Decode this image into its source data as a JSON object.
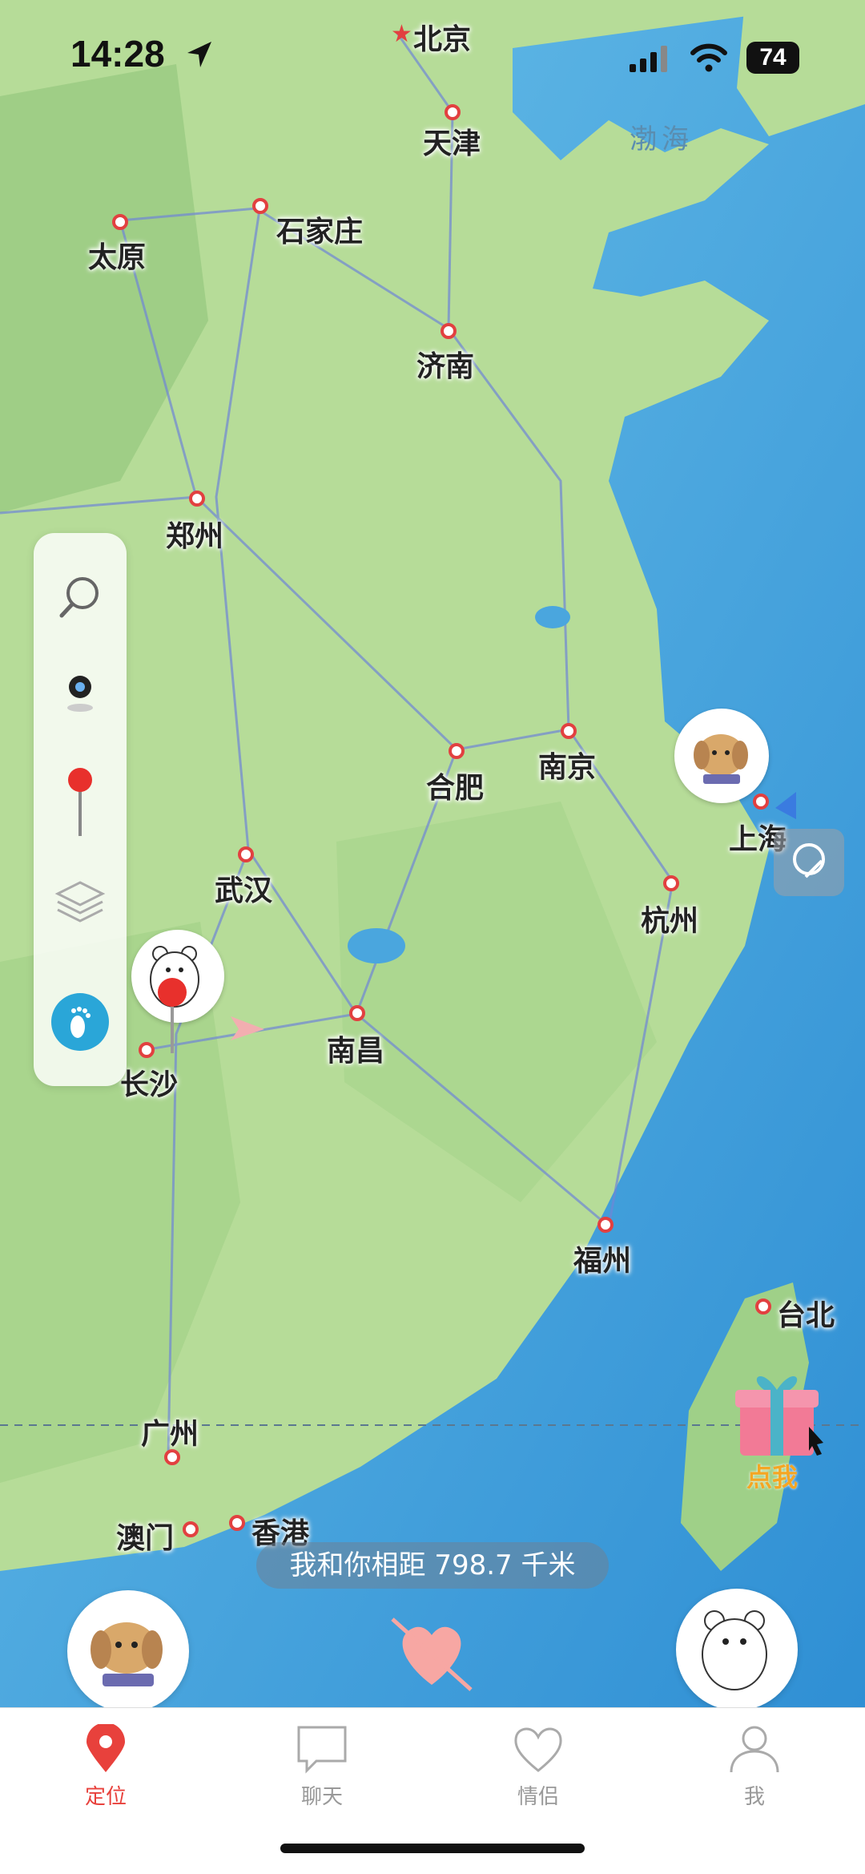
{
  "status_bar": {
    "time": "14:28",
    "battery": "74"
  },
  "map": {
    "cities": [
      {
        "id": "beijing",
        "name": "北京"
      },
      {
        "id": "tianjin",
        "name": "天津"
      },
      {
        "id": "taiyuan",
        "name": "太原"
      },
      {
        "id": "shijiazhuang",
        "name": "石家庄"
      },
      {
        "id": "jinan",
        "name": "济南"
      },
      {
        "id": "zhengzhou",
        "name": "郑州"
      },
      {
        "id": "nanjing",
        "name": "南京"
      },
      {
        "id": "hefei",
        "name": "合肥"
      },
      {
        "id": "shanghai",
        "name": "上海"
      },
      {
        "id": "wuhan",
        "name": "武汉"
      },
      {
        "id": "hangzhou",
        "name": "杭州"
      },
      {
        "id": "changsha",
        "name": "长沙"
      },
      {
        "id": "nanchang",
        "name": "南昌"
      },
      {
        "id": "fuzhou",
        "name": "福州"
      },
      {
        "id": "taibei",
        "name": "台北"
      },
      {
        "id": "guangzhou",
        "name": "广州"
      },
      {
        "id": "aomen",
        "name": "澳门"
      },
      {
        "id": "xianggang",
        "name": "香港"
      }
    ],
    "sea_label": "渤海",
    "gift_label": "点我"
  },
  "distance_text": "我和你相距 798.7 千米",
  "tabs": [
    {
      "label": "定位",
      "icon": "location-pin-icon",
      "active": true
    },
    {
      "label": "聊天",
      "icon": "chat-bubble-icon",
      "active": false
    },
    {
      "label": "情侣",
      "icon": "heart-icon",
      "active": false
    },
    {
      "label": "我",
      "icon": "person-icon",
      "active": false
    }
  ],
  "colors": {
    "accent": "#e8413c",
    "sea": "#4aa6de",
    "land": "#b9de9c",
    "footprint": "#2aa6d8"
  }
}
